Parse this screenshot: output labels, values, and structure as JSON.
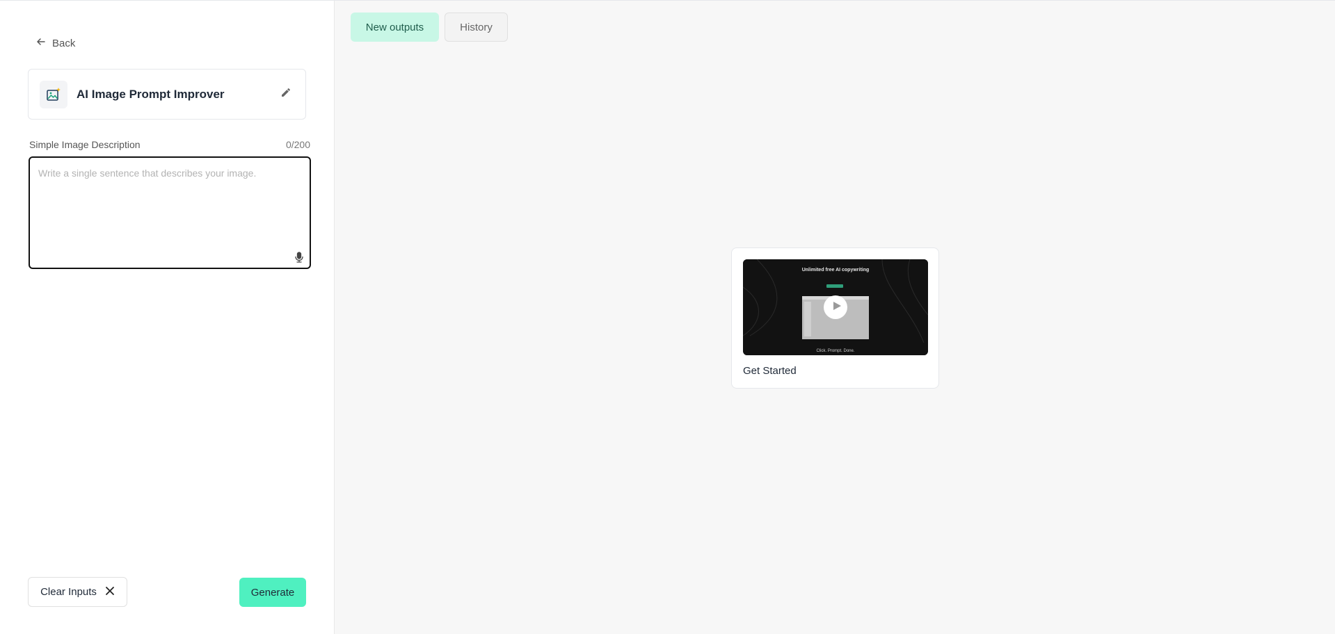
{
  "sidebar": {
    "back_label": "Back",
    "tool": {
      "title": "AI Image Prompt Improver",
      "icon": "image-sparkle-icon"
    },
    "field": {
      "label": "Simple Image Description",
      "count": "0/200",
      "value": "",
      "placeholder": "Write a single sentence that describes your image."
    },
    "clear_label": "Clear Inputs",
    "generate_label": "Generate"
  },
  "main": {
    "tabs": [
      {
        "label": "New outputs",
        "active": true
      },
      {
        "label": "History",
        "active": false
      }
    ],
    "card": {
      "title": "Get Started",
      "thumbnail_heading": "Unlimited free AI copywriting",
      "thumbnail_footer": "Click. Prompt. Done."
    }
  },
  "colors": {
    "accent": "#4ff0c0",
    "tab_active_bg": "#c8f7e6",
    "main_bg": "#f7f7f7"
  }
}
